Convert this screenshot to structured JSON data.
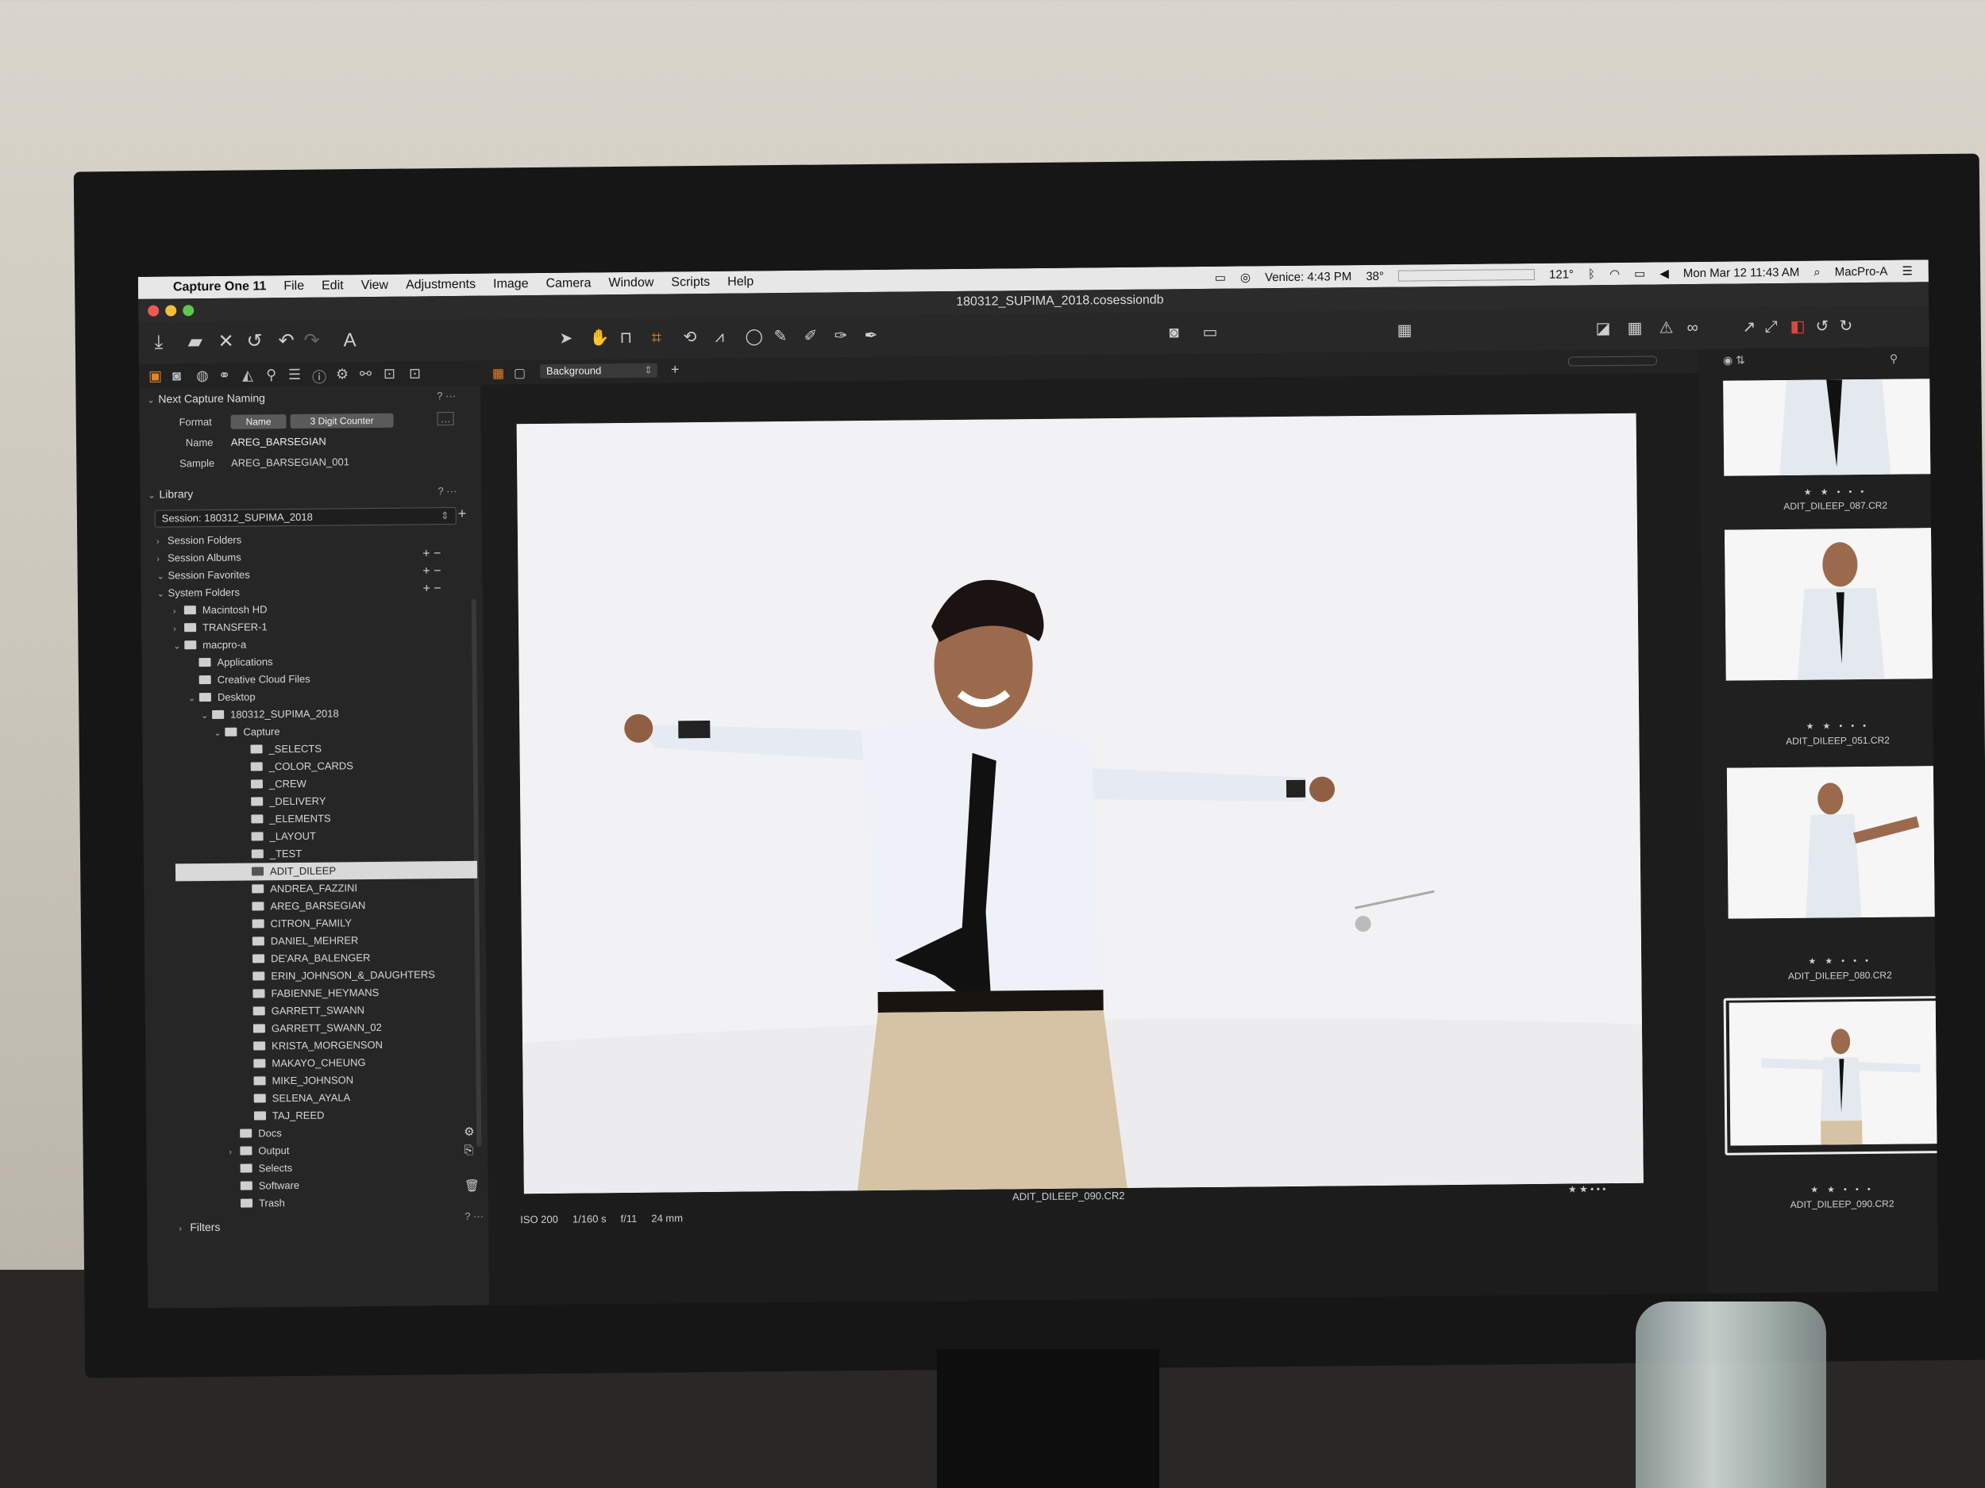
{
  "menubar": {
    "app": "Capture One 11",
    "items": [
      "File",
      "Edit",
      "View",
      "Adjustments",
      "Image",
      "Camera",
      "Window",
      "Scripts",
      "Help"
    ],
    "status": {
      "location_time": "Venice: 4:43 PM",
      "weather": "38°",
      "temp": "121°",
      "datetime": "Mon Mar 12  11:43 AM",
      "computer": "MacPro-A"
    }
  },
  "window": {
    "title": "180312_SUPIMA_2018.cosessiondb"
  },
  "capture_naming": {
    "header": "Next Capture Naming",
    "format_label": "Format",
    "format_name": "Name",
    "format_counter": "3 Digit Counter",
    "name_label": "Name",
    "name_value": "AREG_BARSEGIAN",
    "sample_label": "Sample",
    "sample_value": "AREG_BARSEGIAN_001"
  },
  "library": {
    "header": "Library",
    "session": "Session: 180312_SUPIMA_2018",
    "groups": [
      "Session Folders",
      "Session Albums",
      "Session Favorites",
      "System Folders"
    ],
    "tree": {
      "macintosh_hd": "Macintosh HD",
      "transfer": "TRANSFER-1",
      "user": "macpro-a",
      "applications": "Applications",
      "creative_cloud": "Creative Cloud Files",
      "desktop": "Desktop",
      "session_folder": "180312_SUPIMA_2018",
      "capture": "Capture",
      "capture_folders": [
        "_SELECTS",
        "_COLOR_CARDS",
        "_CREW",
        "_DELIVERY",
        "_ELEMENTS",
        "_LAYOUT",
        "_TEST",
        "ADIT_DILEEP",
        "ANDREA_FAZZINI",
        "AREG_BARSEGIAN",
        "CITRON_FAMILY",
        "DANIEL_MEHRER",
        "DE'ARA_BALENGER",
        "ERIN_JOHNSON_&_DAUGHTERS",
        "FABIENNE_HEYMANS",
        "GARRETT_SWANN",
        "GARRETT_SWANN_02",
        "KRISTA_MORGENSON",
        "MAKAYO_CHEUNG",
        "MIKE_JOHNSON",
        "SELENA_AYALA",
        "TAJ_REED"
      ],
      "after": [
        "Docs",
        "Output",
        "Selects",
        "Software",
        "Trash"
      ]
    },
    "filters": "Filters"
  },
  "viewer": {
    "style": "Background",
    "filename": "ADIT_DILEEP_090.CR2",
    "exif": {
      "iso": "ISO 200",
      "shutter": "1/160 s",
      "aperture": "f/11",
      "focal": "24 mm"
    },
    "stars": "★ ★ • • •"
  },
  "browser": {
    "thumbs": [
      {
        "name": "ADIT_DILEEP_087.CR2",
        "stars": "★ ★ • • •"
      },
      {
        "name": "ADIT_DILEEP_051.CR2",
        "stars": "★ ★ • • •"
      },
      {
        "name": "ADIT_DILEEP_080.CR2",
        "stars": "★ ★ • • •"
      },
      {
        "name": "ADIT_DILEEP_090.CR2",
        "stars": "★ ★ • • •"
      }
    ]
  }
}
